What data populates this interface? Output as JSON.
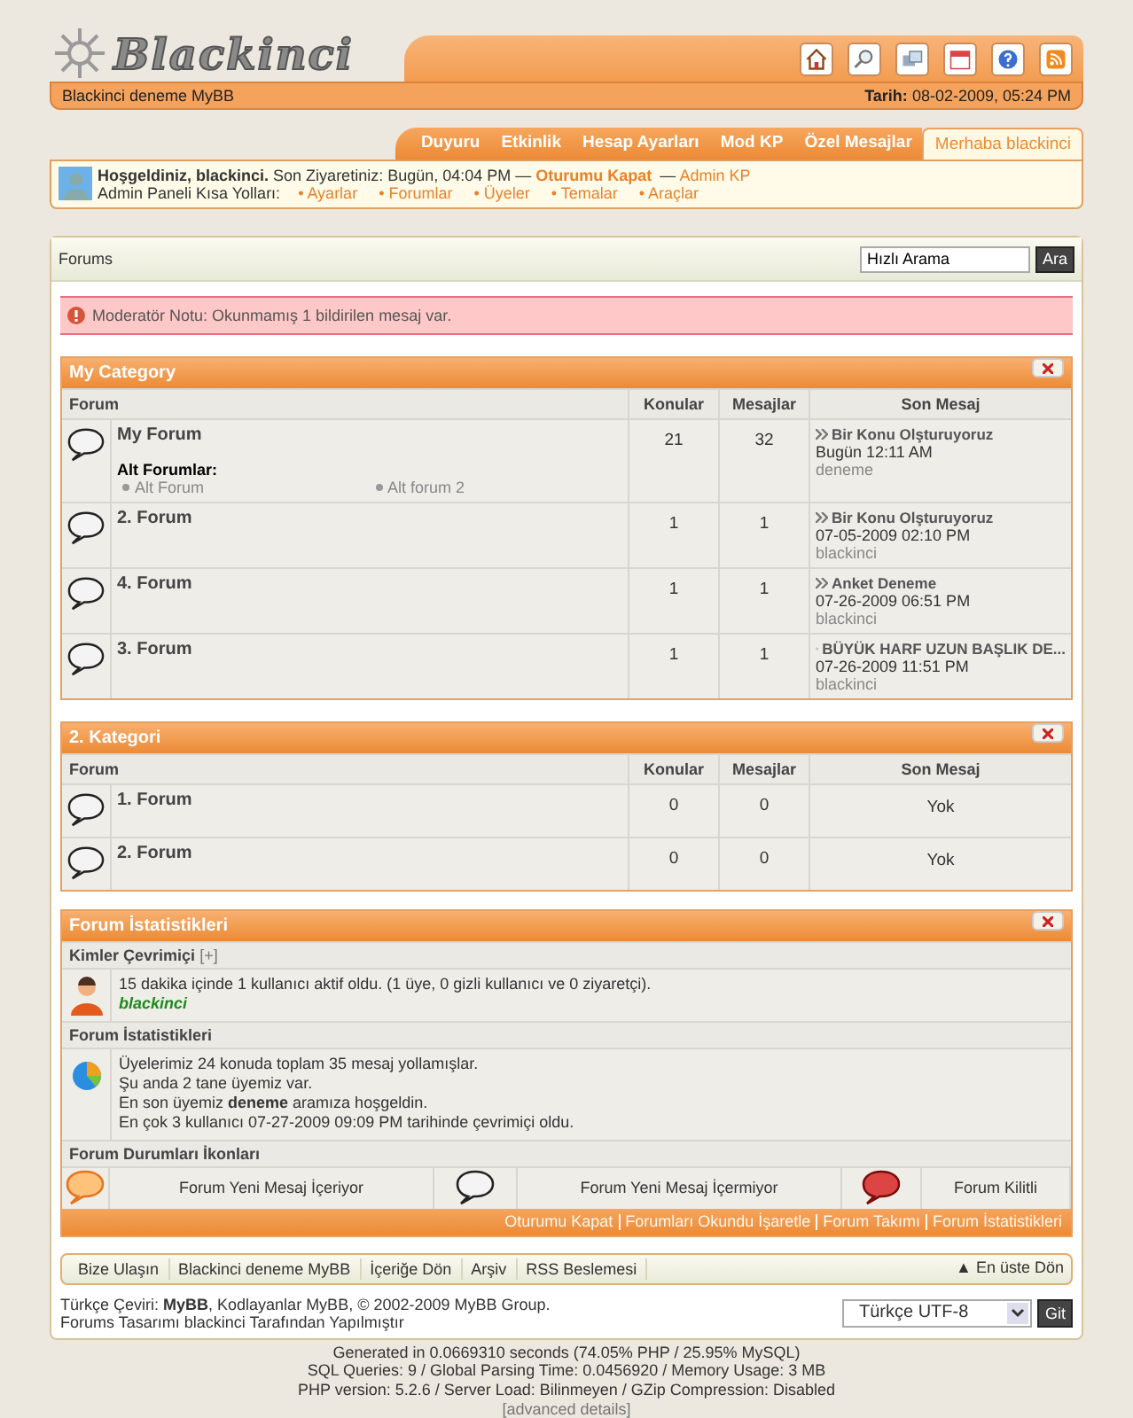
{
  "header": {
    "logo": "Blackinci",
    "site_name": "Blackinci deneme MyBB",
    "date_label": "Tarih:",
    "date": "08-02-2009, 05:24 PM"
  },
  "tabs": [
    {
      "label": "Duyuru",
      "selected": false
    },
    {
      "label": "Etkinlik",
      "selected": false
    },
    {
      "label": "Hesap Ayarları",
      "selected": false
    },
    {
      "label": "Mod KP",
      "selected": false
    },
    {
      "label": "Özel Mesajlar",
      "selected": false
    },
    {
      "label": "Merhaba blackinci",
      "selected": true
    }
  ],
  "welcome": {
    "greeting": "Hoşgeldiniz, blackinci.",
    "last_visit": "Son Ziyaretiniz: Bugün, 04:04 PM —",
    "logout": "Oturumu Kapat",
    "separator": "—",
    "admin": "Admin KP",
    "shortcuts_label": "Admin Paneli Kısa Yolları:",
    "shortcuts": [
      "• Ayarlar",
      "• Forumlar",
      "• Üyeler",
      "• Temalar",
      "• Araçlar"
    ]
  },
  "breadcrumb": "Forums",
  "search": {
    "value": "Hızlı Arama",
    "button": "Ara"
  },
  "alert": "Moderatör Notu: Okunmamış 1 bildirilen mesaj var.",
  "categories": [
    {
      "title": "My Category",
      "columns": [
        "Forum",
        "Konular",
        "Mesajlar",
        "Son Mesaj"
      ],
      "forums": [
        {
          "name": "My Forum",
          "kind": "old",
          "subforums_label": "Alt Forumlar:",
          "subforums": [
            "Alt Forum",
            "Alt forum 2"
          ],
          "topics": "21",
          "posts": "32",
          "last_post": {
            "title": "Bir Konu Olşturuyoruz",
            "date": "Bugün 12:11 AM",
            "user": "deneme"
          }
        },
        {
          "name": "2. Forum",
          "kind": "old",
          "topics": "1",
          "posts": "1",
          "last_post": {
            "title": "Bir Konu Olşturuyoruz",
            "date": "07-05-2009 02:10 PM",
            "user": "blackinci"
          }
        },
        {
          "name": "4. Forum",
          "kind": "old",
          "topics": "1",
          "posts": "1",
          "last_post": {
            "title": "Anket Deneme",
            "date": "07-26-2009 06:51 PM",
            "user": "blackinci"
          }
        },
        {
          "name": "3. Forum",
          "kind": "old",
          "topics": "1",
          "posts": "1",
          "last_post": {
            "title": "BÜYÜK HARF UZUN BAŞLIK DE...",
            "date": "07-26-2009 11:51 PM",
            "user": "blackinci"
          }
        }
      ]
    },
    {
      "title": "2. Kategori",
      "columns": [
        "Forum",
        "Konular",
        "Mesajlar",
        "Son Mesaj"
      ],
      "forums": [
        {
          "name": "1. Forum",
          "kind": "old",
          "topics": "0",
          "posts": "0",
          "no_post": "Yok"
        },
        {
          "name": "2. Forum",
          "kind": "old",
          "topics": "0",
          "posts": "0",
          "no_post": "Yok"
        }
      ]
    }
  ],
  "stats": {
    "title": "Forum İstatistikleri",
    "online_heading": "Kimler Çevrimiçi",
    "online_toggle": "[+]",
    "online_text": "15 dakika içinde 1 kullanıcı aktif oldu. (1 üye, 0 gizli kullanıcı ve 0 ziyaretçi).",
    "online_user": "blackinci",
    "stats_heading": "Forum İstatistikleri",
    "stats_lines": [
      "Üyelerimiz 24 konuda toplam 35 mesaj yollamışlar.",
      "Şu anda 2 tane üyemiz var.",
      "En son üyemiz **deneme** aramıza hoşgeldin.",
      "En çok 3 kullanıcı 07-27-2009 09:09 PM tarihinde çevrimiçi oldu."
    ],
    "legend_heading": "Forum Durumları İkonları",
    "legend": [
      {
        "kind": "new",
        "label": "Forum Yeni Mesaj İçeriyor"
      },
      {
        "kind": "old",
        "label": "Forum Yeni Mesaj İçermiyor"
      },
      {
        "kind": "locked",
        "label": "Forum Kilitli"
      }
    ],
    "footer_links": [
      "Oturumu Kapat",
      "Forumları Okundu İşaretle",
      "Forum Takımı",
      "Forum İstatistikleri"
    ]
  },
  "footer": {
    "links": [
      "Bize Ulaşın",
      "Blackinci deneme MyBB",
      "İçeriğe Dön",
      "Arşiv",
      "RSS Beslemesi"
    ],
    "top_link": "▲ En üste Dön",
    "credits": [
      "Türkçe Çeviri: **MyBB**, Kodlayanlar MyBB, © 2002-2009 MyBB Group.",
      "Forums Tasarımı blackinci Tarafından Yapılmıştır"
    ],
    "language": "Türkçe UTF-8",
    "language_button": "Git"
  },
  "debug": [
    "Generated in 0.0669310 seconds (74.05% PHP / 25.95% MySQL)",
    "SQL Queries: 9 / Global Parsing Time: 0.0456920 / Memory Usage: 3 MB",
    "PHP version: 5.2.6 / Server Load: Bilinmeyen / GZip Compression: Disabled"
  ],
  "debug_link": "[advanced details]"
}
